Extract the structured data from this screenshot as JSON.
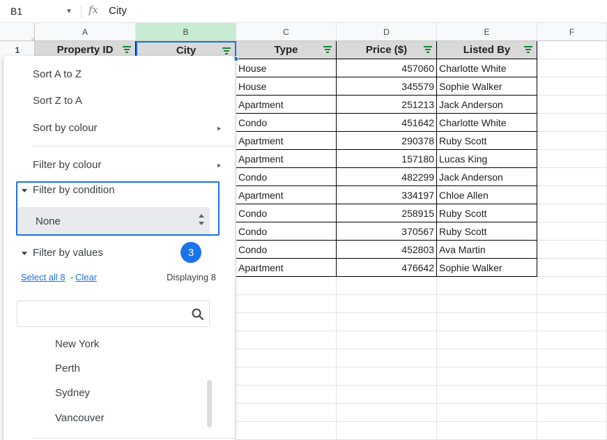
{
  "formula_bar": {
    "name_box": "B1",
    "fx_label": "fx",
    "content": "City"
  },
  "columns": [
    "A",
    "B",
    "C",
    "D",
    "E",
    "F"
  ],
  "rows": [
    "1"
  ],
  "headers": {
    "a": "Property ID",
    "b": "City",
    "c": "Type",
    "d": "Price ($)",
    "e": "Listed By"
  },
  "table_rows": [
    {
      "type": "House",
      "price": "457060",
      "listed_by": "Charlotte White"
    },
    {
      "type": "House",
      "price": "345579",
      "listed_by": "Sophie Walker"
    },
    {
      "type": "Apartment",
      "price": "251213",
      "listed_by": "Jack Anderson"
    },
    {
      "type": "Condo",
      "price": "451642",
      "listed_by": "Charlotte White"
    },
    {
      "type": "Apartment",
      "price": "290378",
      "listed_by": "Ruby Scott"
    },
    {
      "type": "Apartment",
      "price": "157180",
      "listed_by": "Lucas King"
    },
    {
      "type": "Condo",
      "price": "482299",
      "listed_by": "Jack Anderson"
    },
    {
      "type": "Apartment",
      "price": "334197",
      "listed_by": "Chloe Allen"
    },
    {
      "type": "Condo",
      "price": "258915",
      "listed_by": "Ruby Scott"
    },
    {
      "type": "Condo",
      "price": "370567",
      "listed_by": "Ruby Scott"
    },
    {
      "type": "Condo",
      "price": "452803",
      "listed_by": "Ava Martin"
    },
    {
      "type": "Apartment",
      "price": "476642",
      "listed_by": "Sophie Walker"
    }
  ],
  "filter_menu": {
    "sort_az": "Sort A to Z",
    "sort_za": "Sort Z to A",
    "sort_colour": "Sort by colour",
    "filter_colour": "Filter by colour",
    "filter_condition": "Filter by condition",
    "condition_value": "None",
    "filter_values": "Filter by values",
    "badge": "3",
    "select_all": "Select all 8",
    "separator": "-",
    "clear": "Clear",
    "displaying": "Displaying 8",
    "search_placeholder": "",
    "values": [
      "New York",
      "Perth",
      "Sydney",
      "Vancouver"
    ]
  },
  "colors": {
    "accent": "#1a73e8",
    "filter_icon": "#188038",
    "header_fill": "#d9d9d9",
    "selected_col_header": "#c8ecd2"
  }
}
